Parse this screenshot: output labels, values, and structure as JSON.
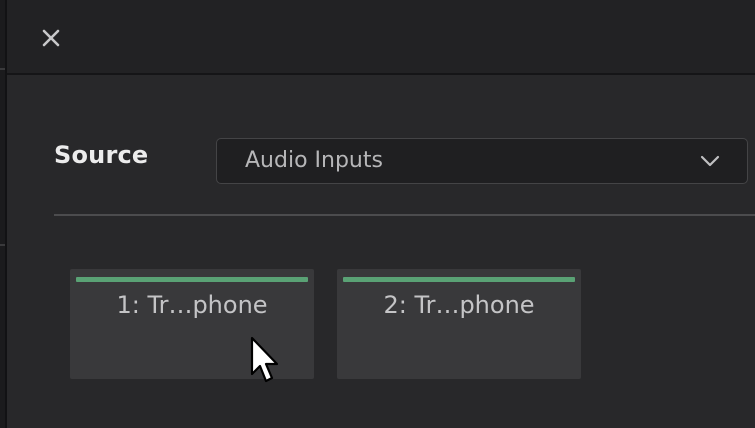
{
  "titlebar": {
    "close_icon": "close-icon"
  },
  "source": {
    "label": "Source",
    "selected": "Audio Inputs",
    "dropdown_icon": "chevron-down-icon"
  },
  "inputs": [
    {
      "label": "1: Tr…phone",
      "level_color": "#5aa275"
    },
    {
      "label": "2: Tr…phone",
      "level_color": "#5aa275"
    }
  ],
  "colors": {
    "accent": "#5aa275",
    "background": "#28282a",
    "tile": "#39393b"
  }
}
